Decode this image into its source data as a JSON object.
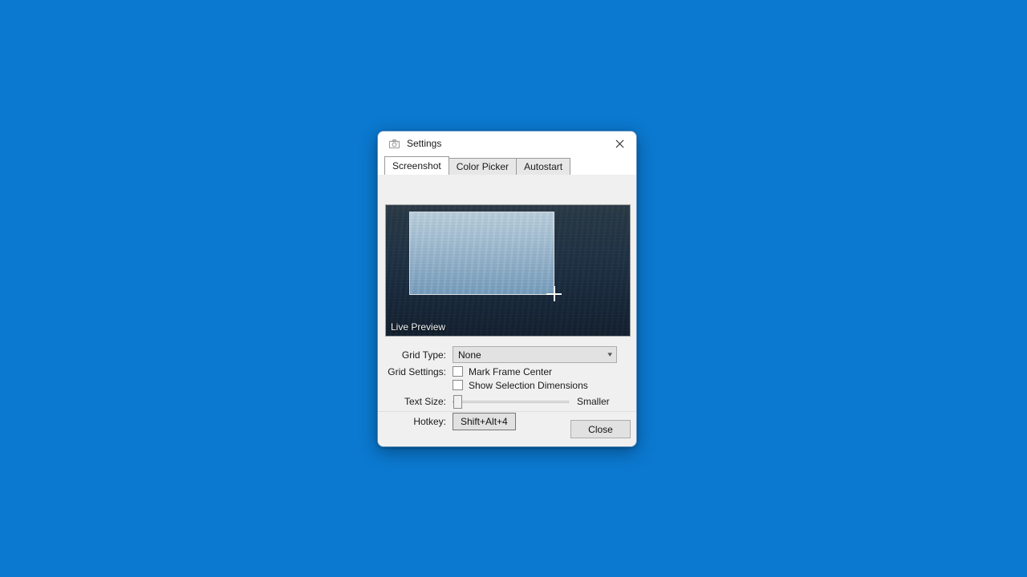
{
  "desktop": {
    "background_color": "#0b79d0"
  },
  "window": {
    "title": "Settings",
    "icon": "camera-icon",
    "close_icon": "close-icon"
  },
  "tabs": [
    {
      "label": "Screenshot",
      "active": true
    },
    {
      "label": "Color Picker",
      "active": false
    },
    {
      "label": "Autostart",
      "active": false
    }
  ],
  "preview": {
    "label": "Live Preview",
    "cursor_icon": "crosshair-icon",
    "selection_visible": true
  },
  "form": {
    "grid_type": {
      "label": "Grid Type:",
      "value": "None",
      "chevron_icon": "chevron-down-icon"
    },
    "grid_settings": {
      "label": "Grid Settings:",
      "checkboxes": [
        {
          "label": "Mark Frame Center",
          "checked": false
        },
        {
          "label": "Show Selection Dimensions",
          "checked": false
        }
      ]
    },
    "text_size": {
      "label": "Text Size:",
      "value": "Smaller",
      "position_percent": 0
    },
    "hotkey": {
      "label": "Hotkey:",
      "value": "Shift+Alt+4"
    }
  },
  "footer": {
    "close_label": "Close"
  }
}
